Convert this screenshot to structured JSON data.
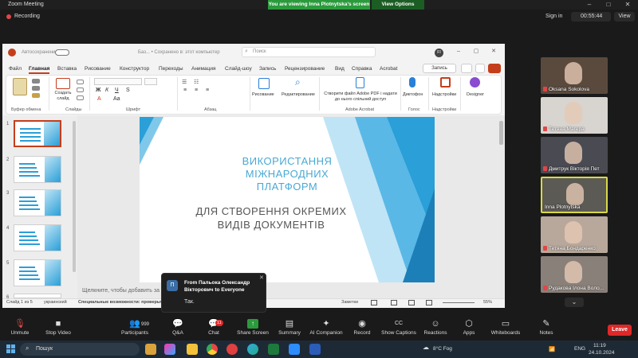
{
  "zoom": {
    "title": "Zoom Meeting",
    "share_banner": "You are viewing Inna Plotnytska's screen",
    "view_options": "View Options",
    "recording": "Recording",
    "sign_in": "Sign in",
    "timer": "00:55:44",
    "view": "View"
  },
  "ppt": {
    "autosave": "Автосохранение",
    "doc_title": "Баз... • Сохранено в: этот компьютер",
    "search_placeholder": "Поиск",
    "user_initials": "FI",
    "menu": [
      "Файл",
      "Главная",
      "Вставка",
      "Рисование",
      "Конструктор",
      "Переходы",
      "Анимация",
      "Слайд-шоу",
      "Запись",
      "Рецензирование",
      "Вид",
      "Справка",
      "Acrobat"
    ],
    "write_btn": "Запись",
    "ribbon": {
      "clipboard": "Буфер обмена",
      "slides": "Слайды",
      "create_slide": "Создать слайд",
      "font": "Шрифт",
      "paragraph": "Абзац",
      "drawing": "Рисование",
      "editing": "Редактирование",
      "acrobat_action": "Створити файл Adobe PDF і надати до нього спільний доступ",
      "adobe": "Adobe Acrobat",
      "dictate": "Диктофон",
      "voice": "Голос",
      "addins": "Надстройки",
      "addins_group": "Надстройки",
      "designer": "Designer"
    },
    "slide": {
      "title": "ВИКОРИСТАННЯ МІЖНАРОДНИХ ПЛАТФОРМ",
      "subtitle": "ДЛЯ СТВОРЕННЯ ОКРЕМИХ ВИДІВ ДОКУМЕНТІВ"
    },
    "thumb_numbers": [
      "1",
      "2",
      "3",
      "4",
      "5",
      "6"
    ],
    "notes_placeholder": "Щелкните, чтобы добавить за",
    "status": {
      "slide": "Слайд 1 из 5",
      "lang": "украинский",
      "accessibility": "Специальные возможности: проверьте",
      "notes": "Заметки",
      "zoom": "55%"
    }
  },
  "participants": [
    {
      "name": "Oksana Sokolova"
    },
    {
      "name": "Тетяна Магера"
    },
    {
      "name": "Дмитрук Вікторія Пет"
    },
    {
      "name": "Inna Plotnytska"
    },
    {
      "name": "Тетяна Бондаренко"
    },
    {
      "name": "Рудакова Ілона Воло..."
    }
  ],
  "chat": {
    "avatar": "П",
    "from": "From Пальока Олександр Вікторович to Everyone",
    "message": "Так."
  },
  "toolbar": {
    "unmute": "Unmute",
    "stop_video": "Stop Video",
    "participants": "Participants",
    "participants_count": "999",
    "qa": "Q&A",
    "chat": "Chat",
    "chat_count": "11",
    "share": "Share Screen",
    "summary": "Summary",
    "ai": "AI Companion",
    "record": "Record",
    "captions": "Show Captions",
    "reactions": "Reactions",
    "apps": "Apps",
    "whiteboards": "Whiteboards",
    "notes": "Notes",
    "leave": "Leave"
  },
  "taskbar": {
    "search": "Пошук",
    "weather": "8°C Fog",
    "lang": "ENG",
    "time": "11:19",
    "date": "24.10.2024"
  },
  "colors": {
    "zoom_green": "#2b9a3c",
    "ppt_accent": "#c43e1c",
    "slide_title": "#49a9d4",
    "leave_red": "#e02828"
  }
}
